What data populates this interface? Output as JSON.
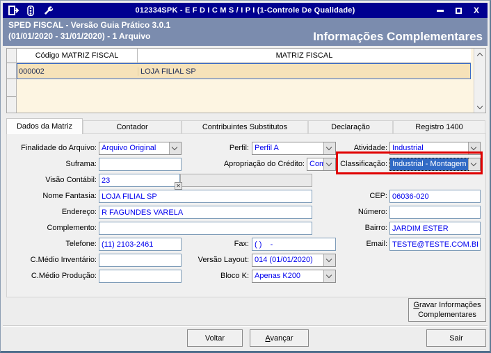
{
  "window": {
    "title": "012334SPK - E F D  I C M S / I P I (1-Controle De Qualidade)"
  },
  "header": {
    "line1": "SPED FISCAL - Versão Guia Prático 3.0.1",
    "line2": "(01/01/2020 - 31/01/2020) - 1 Arquivo",
    "right_title": "Informações Complementares"
  },
  "table": {
    "columns": [
      "Código MATRIZ FISCAL",
      "MATRIZ FISCAL"
    ],
    "rows": [
      {
        "codigo": "000002",
        "matriz": "LOJA FILIAL SP"
      }
    ]
  },
  "tabs": [
    "Dados da Matriz",
    "Contador",
    "Contribuintes Substitutos",
    "Declaração",
    "Registro 1400"
  ],
  "active_tab": "Dados da Matriz",
  "form": {
    "finalidade": {
      "label": "Finalidade do Arquivo:",
      "value": "Arquivo Original"
    },
    "suframa": {
      "label": "Suframa:",
      "value": ""
    },
    "visao_contabil": {
      "label": "Visão Contábil:",
      "value": "23"
    },
    "nome_fantasia": {
      "label": "Nome Fantasia:",
      "value": "LOJA FILIAL SP"
    },
    "endereco": {
      "label": "Endereço:",
      "value": "R FAGUNDES VARELA"
    },
    "complemento": {
      "label": "Complemento:",
      "value": ""
    },
    "telefone": {
      "label": "Telefone:",
      "value": "(11) 2103-2461"
    },
    "c_medio_inventario": {
      "label": "C.Médio Inventário:",
      "value": ""
    },
    "c_medio_producao": {
      "label": "C.Médio Produção:",
      "value": ""
    },
    "perfil": {
      "label": "Perfil:",
      "value": "Perfil A"
    },
    "apropriacao": {
      "label": "Apropriação do Crédito:",
      "value": "Com di"
    },
    "fax": {
      "label": "Fax:",
      "value": "( )    -"
    },
    "versao_layout": {
      "label": "Versão Layout:",
      "value": "014 (01/01/2020)"
    },
    "bloco_k": {
      "label": "Bloco K:",
      "value": "Apenas K200"
    },
    "atividade": {
      "label": "Atividade:",
      "value": "Industrial"
    },
    "classificacao": {
      "label": "Classificação:",
      "value": "Industrial - Montagem"
    },
    "cep": {
      "label": "CEP:",
      "value": "06036-020"
    },
    "numero": {
      "label": "Número:",
      "value": ""
    },
    "bairro": {
      "label": "Bairro:",
      "value": "JARDIM ESTER"
    },
    "email": {
      "label": "Email:",
      "value": "TESTE@TESTE.COM.BR"
    }
  },
  "buttons": {
    "gravar": {
      "line1_u": "G",
      "line1_rest": "ravar Informações",
      "line2": "Complementares"
    },
    "voltar": {
      "label": "Voltar"
    },
    "avancar": {
      "u": "A",
      "rest": "vançar"
    },
    "sair": {
      "label": "Sair"
    }
  },
  "colors": {
    "titlebar": "#000090",
    "header_band": "#7B8CAE",
    "value_text": "#0000EE",
    "row_highlight": "#F6E2B9",
    "row_border": "#3B6BC7",
    "selection": "#316AC5",
    "annotation_red": "#E00000"
  }
}
